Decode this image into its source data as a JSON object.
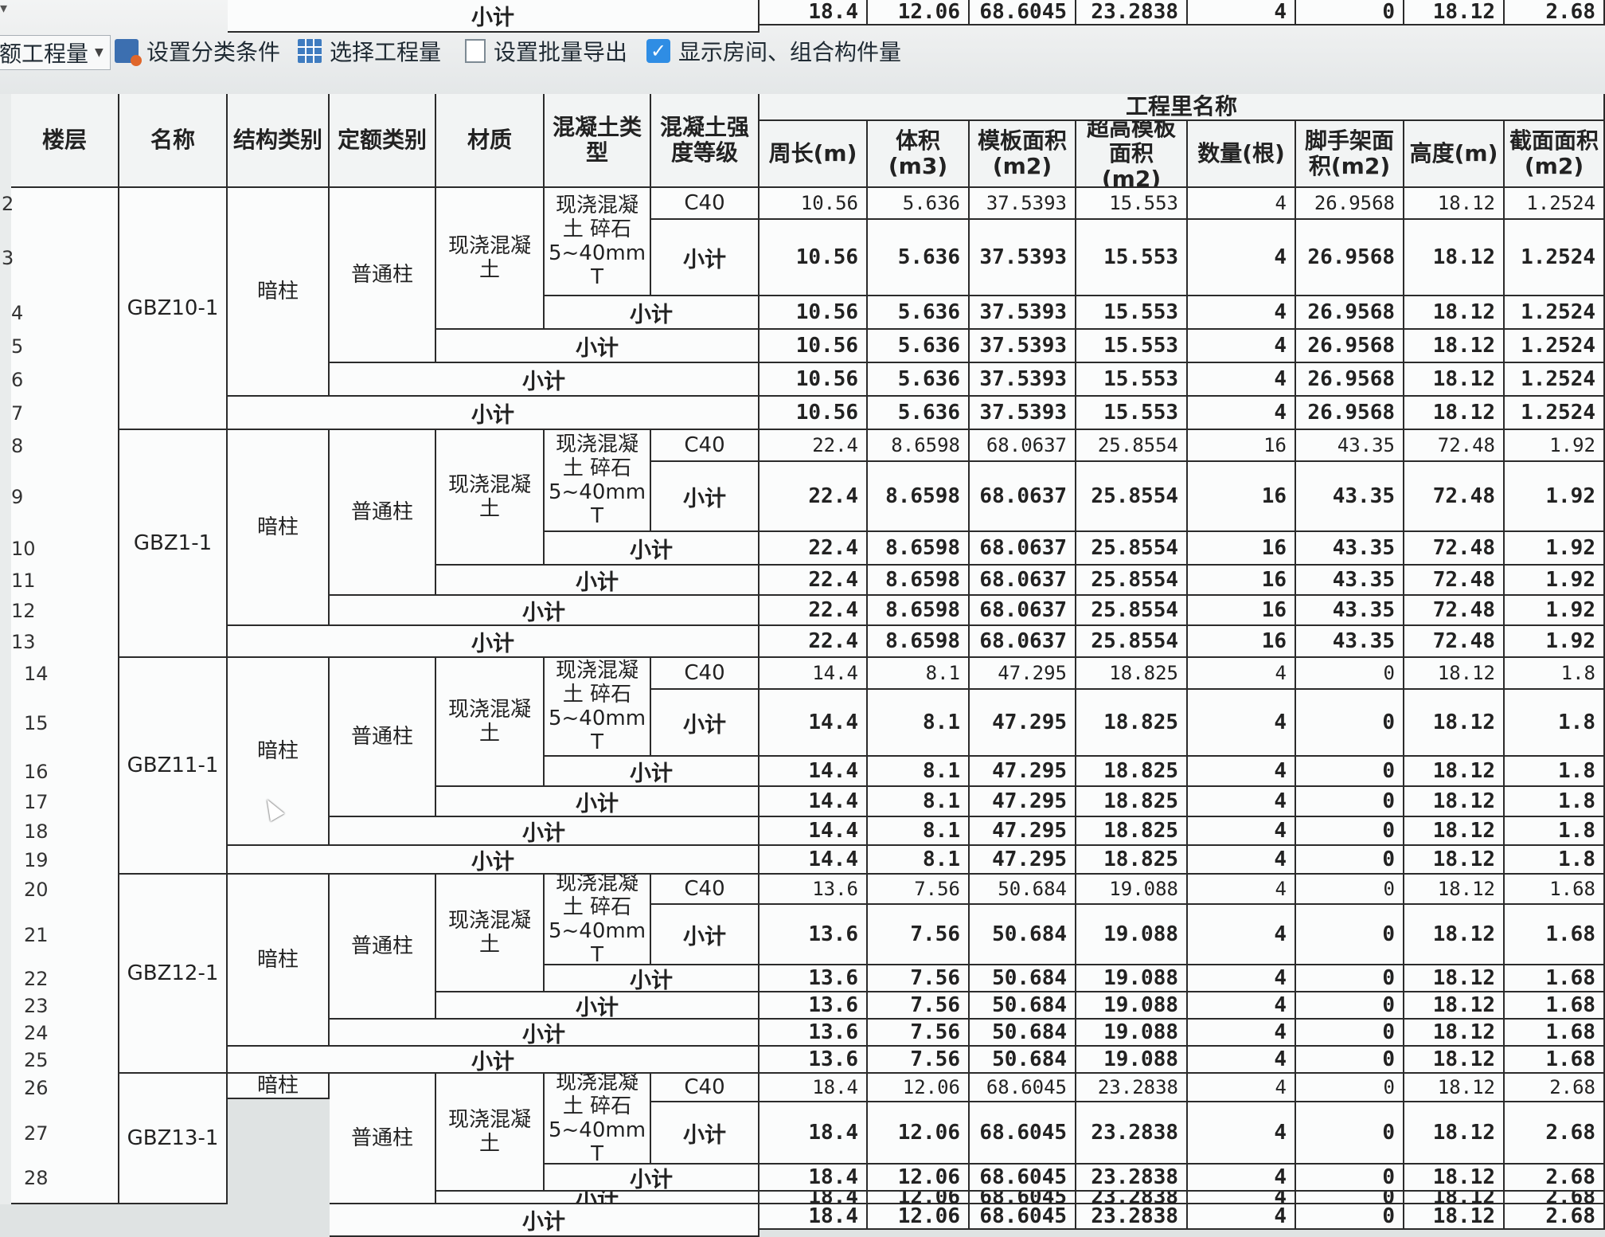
{
  "toolbar": {
    "mark": "▾",
    "items": [
      {
        "label": "额工程量",
        "icon": "dropdown"
      },
      {
        "label": "设置分类条件",
        "icon": "filter-icon"
      },
      {
        "label": "选择工程量",
        "icon": "table-icon"
      },
      {
        "label": "设置批量导出",
        "icon": "export-icon"
      },
      {
        "label": "显示房间、组合构件量",
        "icon": "checkbox-checked",
        "checked": true
      }
    ]
  },
  "table": {
    "headers": {
      "floor": "楼层",
      "name": "名称",
      "struct_type": "结构类别",
      "quota_type": "定额类别",
      "material": "材质",
      "concrete_type": "混凝土类型",
      "concrete_grade": "混凝土强度等级",
      "group": "工程里名称",
      "quantities": [
        "周长(m)",
        "体积(m3)",
        "模板面积(m2)",
        "超高模板面积(m2)",
        "数量(根)",
        "脚手架面积(m2)",
        "高度(m)",
        "截面面积(m2)"
      ]
    },
    "subtotal_label": "小计",
    "row_numbers": [
      "2",
      "3",
      "4",
      "5",
      "6",
      "7",
      "8",
      "9",
      "10",
      "11",
      "12",
      "13",
      "14",
      "15",
      "16",
      "17",
      "18",
      "19",
      "20",
      "21",
      "22",
      "23",
      "24",
      "25",
      "26",
      "27",
      "28"
    ],
    "groups": [
      {
        "name": "GBZ10-1",
        "struct": "暗柱",
        "quota": "普通柱",
        "material": "现浇混凝土",
        "concrete_type": "现浇混凝土 碎石5~40mm T",
        "grade": "C40",
        "values": [
          "10.56",
          "5.636",
          "37.5393",
          "15.553",
          "4",
          "26.9568",
          "18.12",
          "1.2524"
        ]
      },
      {
        "name": "GBZ1-1",
        "struct": "暗柱",
        "quota": "普通柱",
        "material": "现浇混凝土",
        "concrete_type": "现浇混凝土 碎石5~40mm T",
        "grade": "C40",
        "values": [
          "22.4",
          "8.6598",
          "68.0637",
          "25.8554",
          "16",
          "43.35",
          "72.48",
          "1.92"
        ]
      },
      {
        "name": "GBZ11-1",
        "struct": "暗柱",
        "quota": "普通柱",
        "material": "现浇混凝土",
        "concrete_type": "现浇混凝土 碎石5~40mm T",
        "grade": "C40",
        "values": [
          "14.4",
          "8.1",
          "47.295",
          "18.825",
          "4",
          "0",
          "18.12",
          "1.8"
        ]
      },
      {
        "name": "GBZ12-1",
        "struct": "暗柱",
        "quota": "普通柱",
        "material": "现浇混凝土",
        "concrete_type": "现浇混凝土 碎石5~40mm T",
        "grade": "C40",
        "values": [
          "13.6",
          "7.56",
          "50.684",
          "19.088",
          "4",
          "0",
          "18.12",
          "1.68"
        ]
      },
      {
        "name": "GBZ13-1",
        "struct": "暗柱",
        "quota": "普通柱",
        "material": "现浇混凝土",
        "concrete_type": "现浇混凝土 碎石5~40mm T",
        "grade": "C40",
        "values": [
          "18.4",
          "12.06",
          "68.6045",
          "23.2838",
          "4",
          "0",
          "18.12",
          "2.68"
        ]
      }
    ]
  }
}
